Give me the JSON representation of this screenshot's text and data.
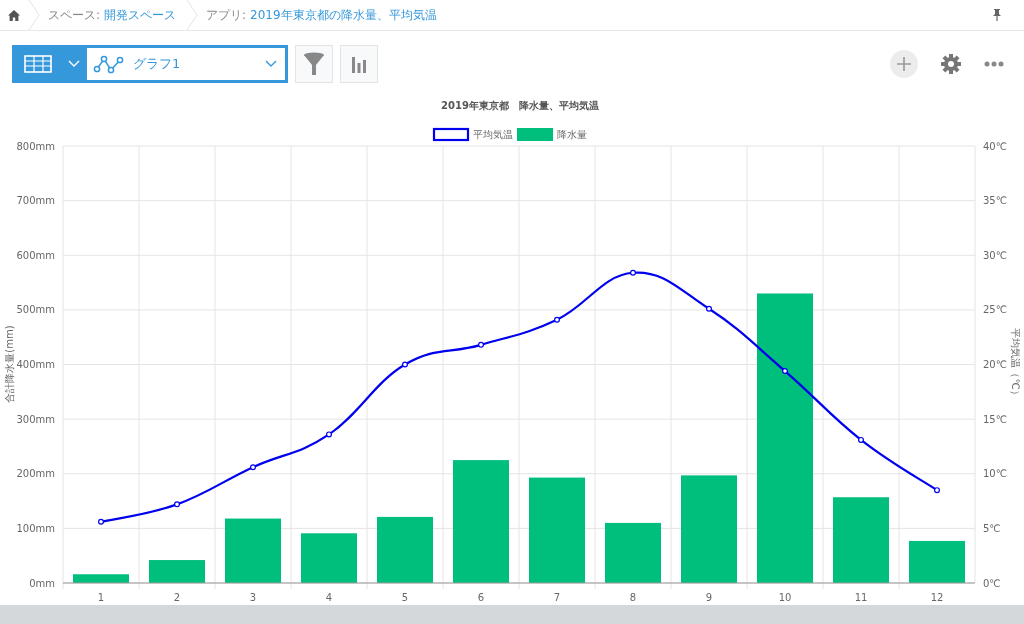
{
  "breadcrumb": [
    {
      "prefix": "スペース:",
      "link": "開発スペース"
    },
    {
      "prefix": "アプリ:",
      "link": "2019年東京都の降水量、平均気温"
    }
  ],
  "toolbar": {
    "graph_select": "グラフ1"
  },
  "chart": {
    "chart_data": {
      "type": "bar",
      "title": "2019年東京都　降水量、平均気温",
      "ylabel": "合計降水量(mm)",
      "y2label": "平均気温（℃）",
      "categories": [
        "1",
        "2",
        "3",
        "4",
        "5",
        "6",
        "7",
        "8",
        "9",
        "10",
        "11",
        "12"
      ],
      "series": [
        {
          "name": "平均気温",
          "type": "line",
          "axis": "y2",
          "marker": true,
          "color": "#0000ee",
          "values": [
            5.6,
            7.2,
            10.6,
            13.6,
            20.0,
            21.8,
            24.1,
            28.4,
            25.1,
            19.4,
            13.1,
            8.5
          ]
        },
        {
          "name": "降水量",
          "type": "bar",
          "axis": "y",
          "color": "#00be7c",
          "values": [
            16,
            42,
            118,
            91,
            121,
            225,
            193,
            110,
            197,
            530,
            157,
            77
          ]
        }
      ],
      "grid": true,
      "legend": "top",
      "ylim": [
        0,
        800
      ],
      "yticks": [
        {
          "value": 0,
          "label": "0mm"
        },
        {
          "value": 100,
          "label": "100mm"
        },
        {
          "value": 200,
          "label": "200mm"
        },
        {
          "value": 300,
          "label": "300mm"
        },
        {
          "value": 400,
          "label": "400mm"
        },
        {
          "value": 500,
          "label": "500mm"
        },
        {
          "value": 600,
          "label": "600mm"
        },
        {
          "value": 700,
          "label": "700mm"
        },
        {
          "value": 800,
          "label": "800mm"
        }
      ],
      "y2lim": [
        0,
        40
      ],
      "y2ticks": [
        {
          "value": 0,
          "label": "0℃"
        },
        {
          "value": 5,
          "label": "5℃"
        },
        {
          "value": 10,
          "label": "10℃"
        },
        {
          "value": 15,
          "label": "15℃"
        },
        {
          "value": 20,
          "label": "20℃"
        },
        {
          "value": 25,
          "label": "25℃"
        },
        {
          "value": 30,
          "label": "30℃"
        },
        {
          "value": 35,
          "label": "35℃"
        },
        {
          "value": 40,
          "label": "40℃"
        }
      ]
    }
  }
}
